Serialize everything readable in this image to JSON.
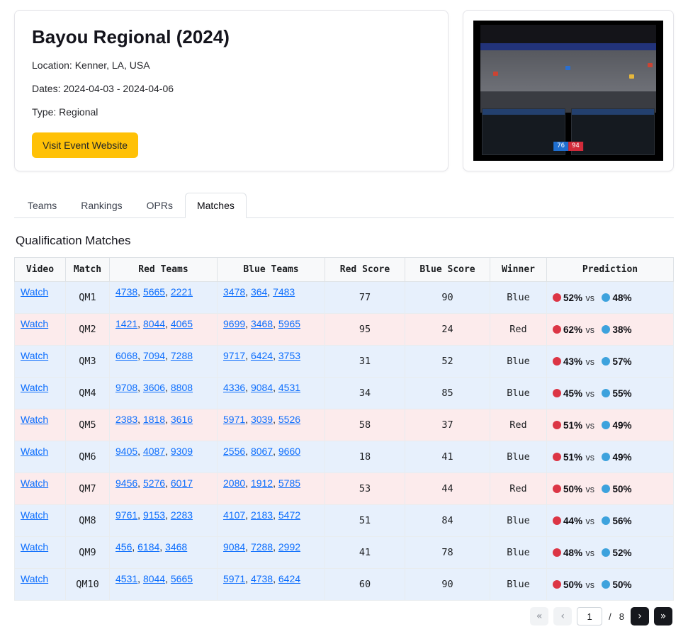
{
  "event": {
    "title": "Bayou Regional (2024)",
    "location": "Location: Kenner, LA, USA",
    "dates": "Dates: 2024-04-03 - 2024-04-06",
    "type": "Type: Regional",
    "website_button": "Visit Event Website"
  },
  "video": {
    "blue_score": "76",
    "red_score": "94"
  },
  "tabs": [
    {
      "label": "Teams",
      "active": false
    },
    {
      "label": "Rankings",
      "active": false
    },
    {
      "label": "OPRs",
      "active": false
    },
    {
      "label": "Matches",
      "active": true
    }
  ],
  "section_title": "Qualification Matches",
  "table": {
    "headers": [
      "Video",
      "Match",
      "Red Teams",
      "Blue Teams",
      "Red Score",
      "Blue Score",
      "Winner",
      "Prediction"
    ],
    "watch_label": "Watch",
    "vs_label": "vs",
    "rows": [
      {
        "match": "QM1",
        "red_teams": [
          "4738",
          "5665",
          "2221"
        ],
        "blue_teams": [
          "3478",
          "364",
          "7483"
        ],
        "red_score": "77",
        "blue_score": "90",
        "winner": "Blue",
        "red_pct": "52%",
        "blue_pct": "48%"
      },
      {
        "match": "QM2",
        "red_teams": [
          "1421",
          "8044",
          "4065"
        ],
        "blue_teams": [
          "9699",
          "3468",
          "5965"
        ],
        "red_score": "95",
        "blue_score": "24",
        "winner": "Red",
        "red_pct": "62%",
        "blue_pct": "38%"
      },
      {
        "match": "QM3",
        "red_teams": [
          "6068",
          "7094",
          "7288"
        ],
        "blue_teams": [
          "9717",
          "6424",
          "3753"
        ],
        "red_score": "31",
        "blue_score": "52",
        "winner": "Blue",
        "red_pct": "43%",
        "blue_pct": "57%"
      },
      {
        "match": "QM4",
        "red_teams": [
          "9708",
          "3606",
          "8808"
        ],
        "blue_teams": [
          "4336",
          "9084",
          "4531"
        ],
        "red_score": "34",
        "blue_score": "85",
        "winner": "Blue",
        "red_pct": "45%",
        "blue_pct": "55%"
      },
      {
        "match": "QM5",
        "red_teams": [
          "2383",
          "1818",
          "3616"
        ],
        "blue_teams": [
          "5971",
          "3039",
          "5526"
        ],
        "red_score": "58",
        "blue_score": "37",
        "winner": "Red",
        "red_pct": "51%",
        "blue_pct": "49%"
      },
      {
        "match": "QM6",
        "red_teams": [
          "9405",
          "4087",
          "9309"
        ],
        "blue_teams": [
          "2556",
          "8067",
          "9660"
        ],
        "red_score": "18",
        "blue_score": "41",
        "winner": "Blue",
        "red_pct": "51%",
        "blue_pct": "49%"
      },
      {
        "match": "QM7",
        "red_teams": [
          "9456",
          "5276",
          "6017"
        ],
        "blue_teams": [
          "2080",
          "1912",
          "5785"
        ],
        "red_score": "53",
        "blue_score": "44",
        "winner": "Red",
        "red_pct": "50%",
        "blue_pct": "50%"
      },
      {
        "match": "QM8",
        "red_teams": [
          "9761",
          "9153",
          "2283"
        ],
        "blue_teams": [
          "4107",
          "2183",
          "5472"
        ],
        "red_score": "51",
        "blue_score": "84",
        "winner": "Blue",
        "red_pct": "44%",
        "blue_pct": "56%"
      },
      {
        "match": "QM9",
        "red_teams": [
          "456",
          "6184",
          "3468"
        ],
        "blue_teams": [
          "9084",
          "7288",
          "2992"
        ],
        "red_score": "41",
        "blue_score": "78",
        "winner": "Blue",
        "red_pct": "48%",
        "blue_pct": "52%"
      },
      {
        "match": "QM10",
        "red_teams": [
          "4531",
          "8044",
          "5665"
        ],
        "blue_teams": [
          "5971",
          "4738",
          "6424"
        ],
        "red_score": "60",
        "blue_score": "90",
        "winner": "Blue",
        "red_pct": "50%",
        "blue_pct": "50%"
      }
    ]
  },
  "pagination": {
    "first": "«",
    "prev": "‹",
    "page": "1",
    "sep": "/",
    "total": "8",
    "next": "›",
    "last": "»"
  },
  "colors": {
    "accent_yellow": "#ffc107",
    "link_blue": "#0d6efd",
    "red_alliance": "#dc3545",
    "blue_alliance": "#3da2dd",
    "row_blue_bg": "#e7f0fc",
    "row_red_bg": "#fcebec"
  }
}
